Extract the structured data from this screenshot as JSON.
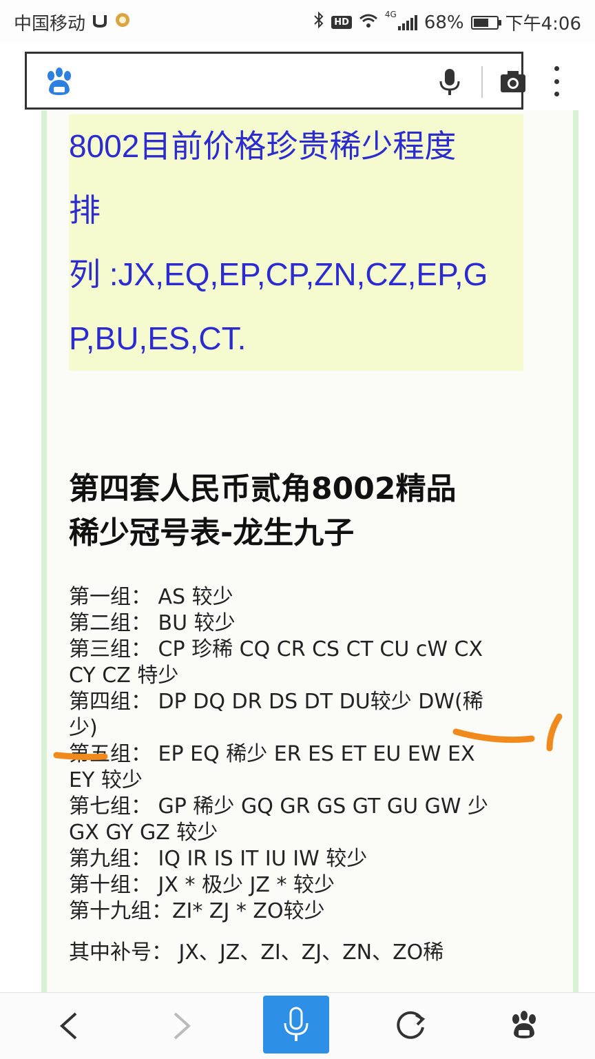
{
  "status": {
    "carrier": "中国移动",
    "hd": "HD",
    "network": "4G",
    "battery": "68%",
    "battery_level": 0.68,
    "time": "下午4:06"
  },
  "promo": {
    "lines": [
      "8002目前价格珍贵稀少程度",
      "排",
      "列 :JX,EQ,EP,CP,ZN,CZ,EP,G",
      "P,BU,ES,CT."
    ]
  },
  "article": {
    "title_lines": [
      "第四套人民币贰角8002精品",
      "稀少冠号表-龙生九子"
    ],
    "list_lines": [
      "第一组：  AS 较少",
      "第二组：  BU 较少",
      "第三组：  CP 珍稀  CQ  CR  CS  CT  CU  cW  CX",
      "CY CZ 特少",
      "第四组：  DP DQ DR DS DT DU较少  DW(稀",
      "少)",
      "第五组：  EP EQ  稀少  ER  ES  ET  EU  EW  EX",
      "EY 较少",
      "第七组：  GP 稀少  GQ  GR  GS  GT  GU  GW  少",
      "GX GY GZ 较少",
      "第九组：  IQ IR IS IT IU IW 较少",
      "第十组：  JX * 极少  JZ * 较少",
      "第十九组：ZI* ZJ * ZO较少"
    ],
    "supplement": "其中补号：  JX、JZ、ZI、ZJ、ZN、ZO稀"
  },
  "colors": {
    "promo_text": "#2b2bd0",
    "promo_bg": "#f6fbcf",
    "frame_border": "#d7f1d3",
    "annotation": "#f08a1c",
    "voice_button": "#2d8fe6"
  }
}
